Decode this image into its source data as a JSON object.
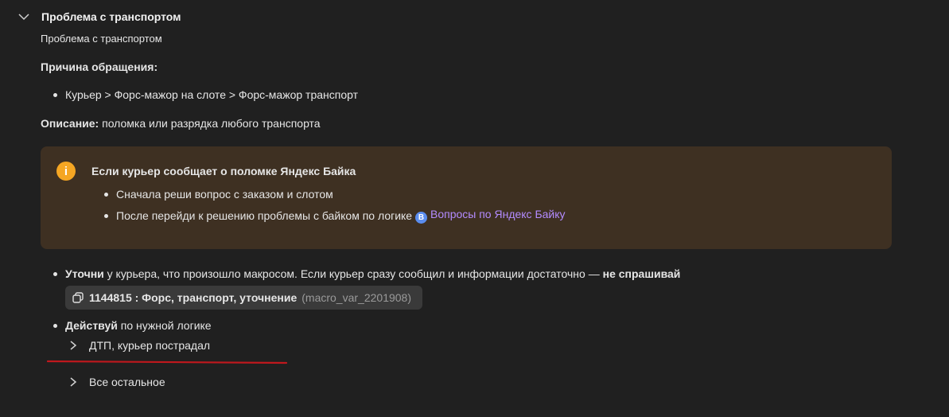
{
  "section": {
    "title": "Проблема с транспортом",
    "subtitle": "Проблема с транспортом",
    "reason_label": "Причина обращения:",
    "reason_item": "Курьер > Форс-мажор на слоте > Форс-мажор транспорт",
    "description_label": "Описание:",
    "description_text": " поломка или разрядка любого транспорта"
  },
  "callout": {
    "title": "Если курьер сообщает о поломке Яндекс Байка",
    "item1": "Сначала реши вопрос с заказом и слотом",
    "item2_text": "После перейди к решению проблемы с байком по логике ",
    "badge": "B",
    "item2_link": "Вопросы по Яндекс Байку"
  },
  "step1": {
    "bold": "Уточни",
    "text": " у курьера, что произошло макросом. Если курьер сразу сообщил и информации достаточно — ",
    "bold_end": "не спрашивай"
  },
  "macro": {
    "label": "1144815 : Форс, транспорт, уточнение",
    "var": "(macro_var_2201908)"
  },
  "step2": {
    "bold": "Действуй",
    "text": " по нужной логике"
  },
  "subitems": {
    "dtp": "ДТП, курьер пострадал",
    "other": "Все остальное"
  },
  "colors": {
    "background": "#202020",
    "callout_bg": "#3e3022",
    "info_icon": "#f5a623",
    "link": "#b38bff",
    "underline": "#c0181d"
  }
}
